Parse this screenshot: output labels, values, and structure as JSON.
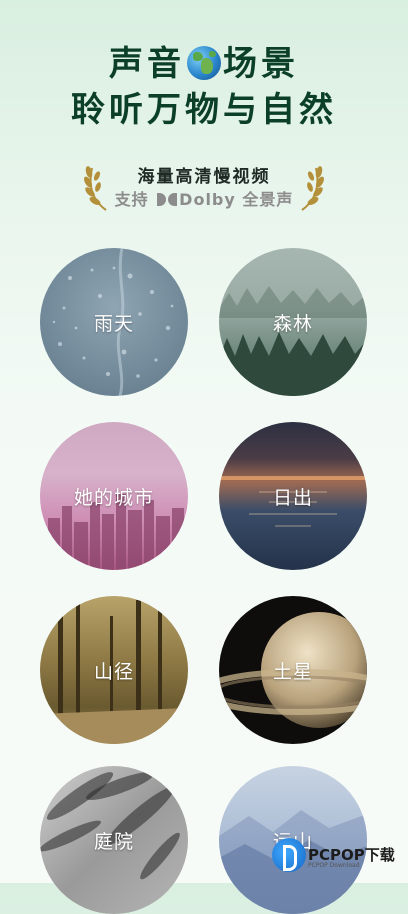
{
  "header": {
    "title_part1": "声音",
    "title_part2": "场景",
    "title_line2": "聆听万物与自然",
    "globe_icon": "globe-icon"
  },
  "badge": {
    "line1": "海量高清慢视频",
    "line2_prefix": "支持",
    "line2_brand": "Dolby",
    "line2_suffix": "全景声",
    "laurel_color": "#b5903a"
  },
  "scenes": [
    {
      "label": "雨天"
    },
    {
      "label": "森林"
    },
    {
      "label": "她的城市"
    },
    {
      "label": "日出"
    },
    {
      "label": "山径"
    },
    {
      "label": "土星"
    },
    {
      "label": "庭院"
    },
    {
      "label": "远山"
    }
  ],
  "watermark": {
    "brand": "PCPOP下载",
    "small": "PCPOP Download"
  },
  "colors": {
    "title": "#0c3f27",
    "background_top": "#d9efe0",
    "background_bottom": "#f7fbf8"
  }
}
